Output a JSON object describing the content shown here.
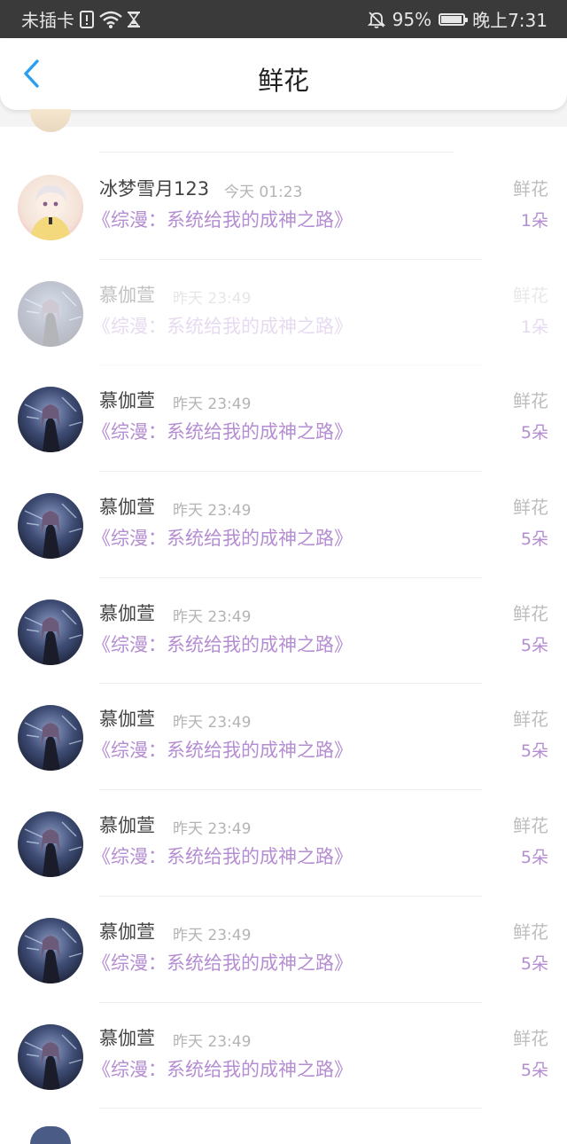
{
  "status_bar": {
    "carrier": "未插卡",
    "battery_percent": "95%",
    "battery_level": 0.95,
    "time": "晚上7:31",
    "icons": [
      "sim-alert-icon",
      "wifi-icon",
      "hourglass-icon",
      "mute-bell-icon",
      "battery-icon"
    ]
  },
  "header": {
    "title": "鲜花",
    "back_icon": "chevron-left-icon"
  },
  "colors": {
    "accent": "#2a9ef0",
    "book_purple": "#b48dd2"
  },
  "rows": [
    {
      "name": "冰梦雪月123",
      "time": "今天 01:23",
      "book": "《综漫：系统给我的成神之路》",
      "gift": "鲜花",
      "count": "1朵",
      "avatar": "light"
    },
    {
      "name": "慕伽萱",
      "time": "昨天 23:49",
      "book": "《综漫：系统给我的成神之路》",
      "gift": "鲜花",
      "count": "1朵",
      "avatar": "dark"
    },
    {
      "name": "慕伽萱",
      "time": "昨天 23:49",
      "book": "《综漫：系统给我的成神之路》",
      "gift": "鲜花",
      "count": "5朵",
      "avatar": "dark"
    },
    {
      "name": "慕伽萱",
      "time": "昨天 23:49",
      "book": "《综漫：系统给我的成神之路》",
      "gift": "鲜花",
      "count": "5朵",
      "avatar": "dark"
    },
    {
      "name": "慕伽萱",
      "time": "昨天 23:49",
      "book": "《综漫：系统给我的成神之路》",
      "gift": "鲜花",
      "count": "5朵",
      "avatar": "dark"
    },
    {
      "name": "慕伽萱",
      "time": "昨天 23:49",
      "book": "《综漫：系统给我的成神之路》",
      "gift": "鲜花",
      "count": "5朵",
      "avatar": "dark"
    },
    {
      "name": "慕伽萱",
      "time": "昨天 23:49",
      "book": "《综漫：系统给我的成神之路》",
      "gift": "鲜花",
      "count": "5朵",
      "avatar": "dark"
    },
    {
      "name": "慕伽萱",
      "time": "昨天 23:49",
      "book": "《综漫：系统给我的成神之路》",
      "gift": "鲜花",
      "count": "5朵",
      "avatar": "dark"
    },
    {
      "name": "慕伽萱",
      "time": "昨天 23:49",
      "book": "《综漫：系统给我的成神之路》",
      "gift": "鲜花",
      "count": "5朵",
      "avatar": "dark"
    }
  ]
}
